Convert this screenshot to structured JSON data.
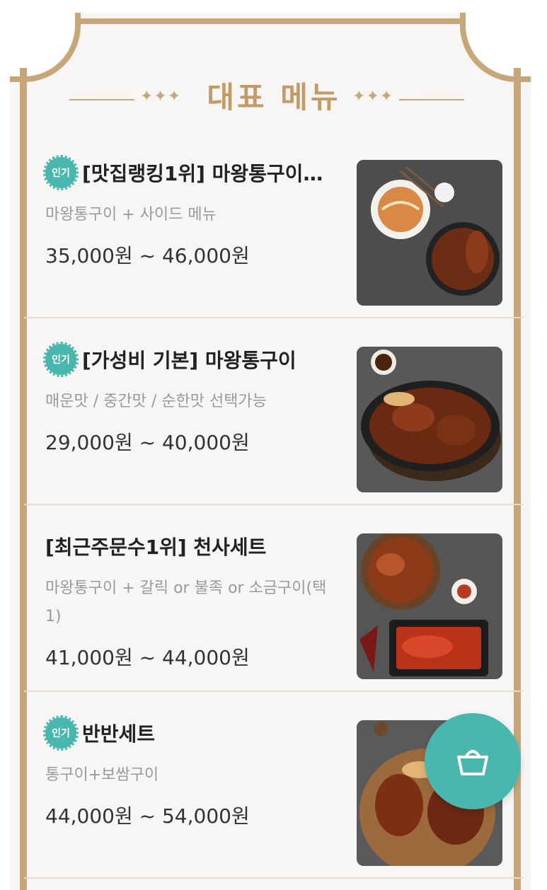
{
  "heading": {
    "title": "대표 메뉴",
    "sparkle": "✦✦✦"
  },
  "menu": [
    {
      "badge": "인기",
      "title": "[맛집랭킹1위] 마왕통구이…",
      "description": "마왕통구이 + 사이드 메뉴",
      "price": "35,000원 ~ 46,000원",
      "image": "pork-noodle-set"
    },
    {
      "badge": "인기",
      "title": "[가성비 기본] 마왕통구이",
      "description": "매운맛 / 중간맛 / 순한맛 선택가능",
      "price": "29,000원 ~ 40,000원",
      "image": "pork-pan"
    },
    {
      "badge": "",
      "title": "[최근주문수1위] 천사세트",
      "description": "마왕통구이 + 갈릭 or 불족 or 소금구이(택1)",
      "price": "41,000원 ~ 44,000원",
      "image": "pork-combo-set"
    },
    {
      "badge": "인기",
      "title": "반반세트",
      "description": "통구이+보쌈구이",
      "price": "44,000원 ~ 54,000원",
      "image": "pork-board"
    }
  ],
  "cart_button": {
    "icon": "basket-icon"
  },
  "colors": {
    "accent": "#49b7ae",
    "gold": "#c7a77a",
    "heading": "#c49a66"
  }
}
